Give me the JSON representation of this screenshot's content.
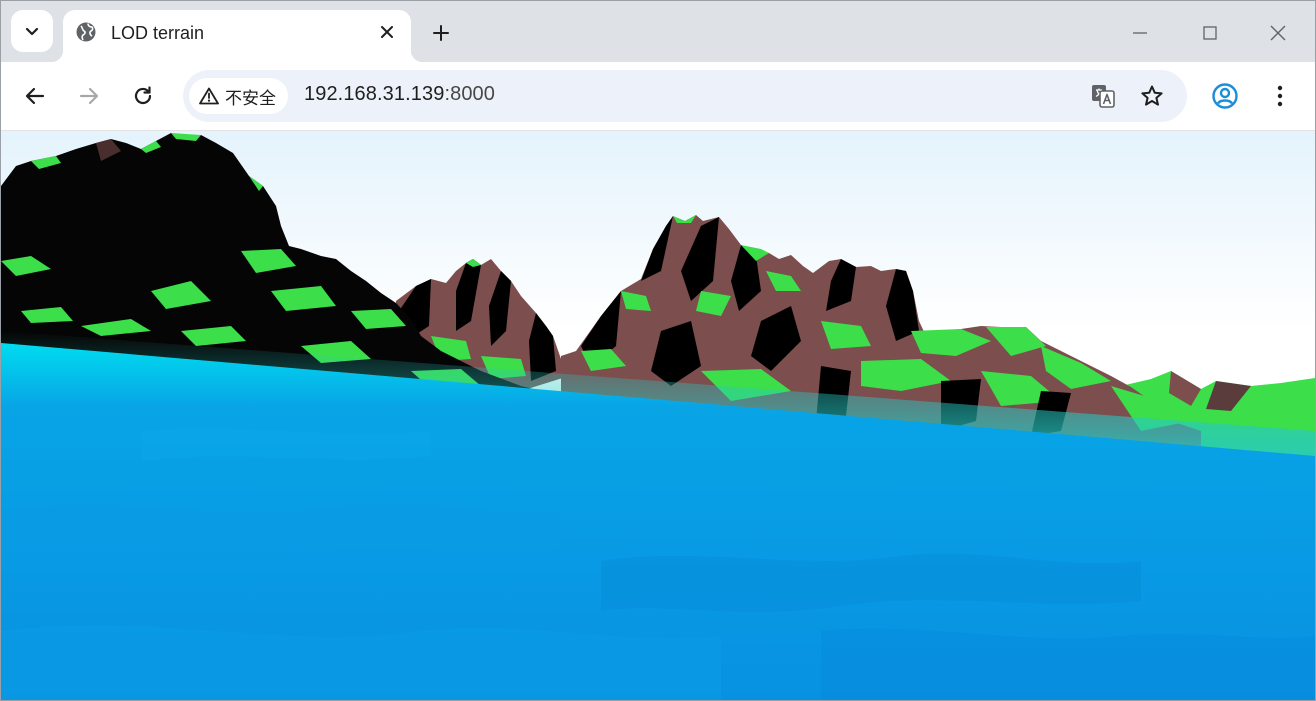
{
  "browser": {
    "tab": {
      "title": "LOD terrain",
      "favicon": "globe-icon"
    },
    "address_bar": {
      "security_label": "不安全",
      "url_host": "192.168.31.139",
      "url_port": ":8000"
    },
    "icons": {
      "tab_search": "chevron-down-icon",
      "tab_close": "close-icon",
      "new_tab": "plus-icon",
      "minimize": "minimize-icon",
      "maximize": "maximize-icon",
      "window_close": "close-icon",
      "back": "arrow-left-icon",
      "forward": "arrow-right-icon",
      "reload": "reload-icon",
      "security_warning": "warning-triangle-icon",
      "translate": "translate-icon",
      "bookmark": "star-icon",
      "profile": "account-circle-icon",
      "menu": "three-dots-vertical-icon"
    },
    "colors": {
      "tab_strip": "#dee1e6",
      "toolbar": "#ffffff",
      "omnibox": "#edf2fa",
      "profile_accent": "#1a8ed8",
      "forward_disabled": "#a8a8a8"
    }
  },
  "scene": {
    "description_colors": {
      "sky_top": "#e4f3fc",
      "sky_bottom": "#ffffff",
      "grass": "#3cde4a",
      "rock": "#7c4e4e",
      "shadow": "#000000",
      "water_shore": "#00dcef",
      "water": "#0891e2"
    }
  }
}
